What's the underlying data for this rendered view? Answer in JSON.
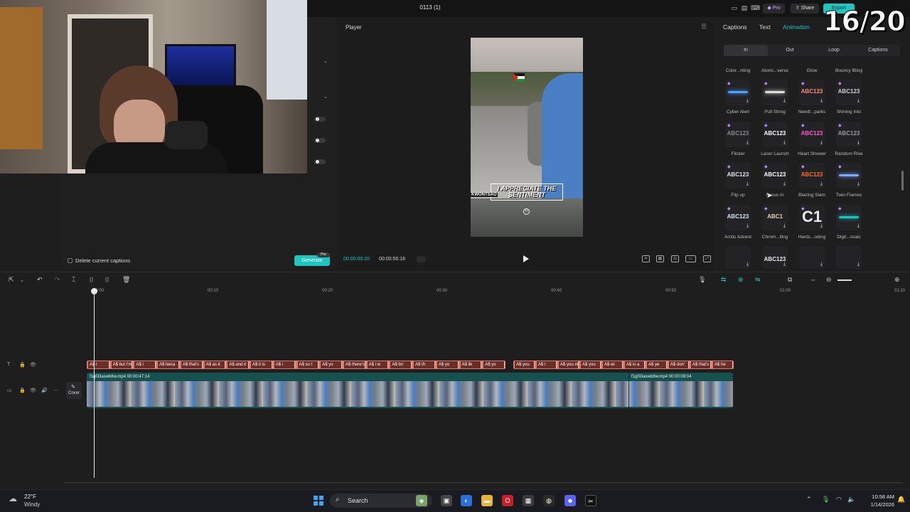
{
  "window": {
    "title": "0113 (1)"
  },
  "topbar": {
    "pro_label": "Pro",
    "share_label": "Share",
    "export_label": "Export"
  },
  "overlay": {
    "counter": "16/20"
  },
  "left_panel": {
    "delete_label": "Delete current captions",
    "generate_label": "Generate",
    "pro_badge": "Pro"
  },
  "player": {
    "title": "Player",
    "current_time": "00:00:00:20",
    "total_time": "00:00:56:18",
    "caption_text": "I APPRECIATE THE SENTIMENT",
    "caption_name": "KWONTSAO"
  },
  "right_panel": {
    "tabs": [
      {
        "label": "Captions",
        "active": false
      },
      {
        "label": "Text",
        "active": false
      },
      {
        "label": "Animation",
        "active": true
      }
    ],
    "subtabs": [
      {
        "label": "In",
        "active": true
      },
      {
        "label": "Out",
        "active": false
      },
      {
        "label": "Loop",
        "active": false
      },
      {
        "label": "Captions",
        "active": false
      }
    ],
    "row0_labels": [
      "Color...nting",
      "Atomi...verse",
      "Glow",
      "Bouncy Bling"
    ],
    "animations": [
      {
        "label": "Cyber Alert",
        "thumb": "",
        "color": "#4aa3ff"
      },
      {
        "label": "Pull String",
        "thumb": "",
        "color": "#dddddd"
      },
      {
        "label": "Needl...parks",
        "thumb": "ABC123",
        "color": "#ff8a7a"
      },
      {
        "label": "Shining Into",
        "thumb": "ABC123",
        "color": "#cfcfcf"
      },
      {
        "label": "Flicker",
        "thumb": "ABC123",
        "color": "#8a8a8a"
      },
      {
        "label": "Laser Launch",
        "thumb": "ABC123",
        "color": "#ffffff"
      },
      {
        "label": "Heart Shower",
        "thumb": "ABC123",
        "color": "#ff5ad1"
      },
      {
        "label": "Random Rise",
        "thumb": "ABC123",
        "color": "#9a9a9a"
      },
      {
        "label": "Flip up",
        "thumb": "ABC123",
        "color": "#e0e0e0"
      },
      {
        "label": "Focus In",
        "thumb": "ABC123",
        "color": "#ffffff"
      },
      {
        "label": "Blazing Slam",
        "thumb": "ABC123",
        "color": "#ff6a2a"
      },
      {
        "label": "Twin Flames",
        "thumb": "",
        "color": "#7aa7ff"
      },
      {
        "label": "Arctic Advent",
        "thumb": "ABC123",
        "color": "#cfe6ff"
      },
      {
        "label": "Chrom...lling",
        "thumb": "ABC1",
        "color": "#e6d2b5"
      },
      {
        "label": "Hardc...oding",
        "thumb": "C1",
        "color": "#e8e8e8"
      },
      {
        "label": "Digit...osaic",
        "thumb": "",
        "color": "#1fc6c0"
      }
    ],
    "last_row_thumbs": [
      "",
      "ABC123",
      "",
      ""
    ]
  },
  "timeline": {
    "ruler": [
      "00:00",
      "00:10",
      "00:20",
      "00:30",
      "00:40",
      "00:50",
      "01:00",
      "01:10"
    ],
    "caption_segments": [
      {
        "text": "A$ i",
        "w": 0
      },
      {
        "text": "A$ but I'm g",
        "w": 0
      },
      {
        "text": "A$ i",
        "w": 0
      },
      {
        "text": "A$ beca",
        "w": 0
      },
      {
        "text": "A$ that's",
        "w": 0
      },
      {
        "text": "A$ as it",
        "w": 0
      },
      {
        "text": "A$ and it",
        "w": 0
      },
      {
        "text": "A$ it is",
        "w": 0
      },
      {
        "text": "A$ i",
        "w": 0
      },
      {
        "text": "A$ so t",
        "w": 0
      },
      {
        "text": "A$ yo",
        "w": 0
      },
      {
        "text": "A$ there's t",
        "w": 0
      },
      {
        "text": "A$ i w",
        "w": 0
      },
      {
        "text": "A$ bri",
        "w": 0
      },
      {
        "text": "A$ th",
        "w": 0
      },
      {
        "text": "A$ yo",
        "w": 0
      },
      {
        "text": "A$ lik",
        "w": 0
      },
      {
        "text": "A$ yo",
        "w": 0
      }
    ],
    "caption_segments_b": [
      {
        "text": "A$ you"
      },
      {
        "text": "A$ l"
      },
      {
        "text": "A$ you m"
      },
      {
        "text": "A$ you"
      },
      {
        "text": "A$ wi"
      },
      {
        "text": "A$ is a"
      },
      {
        "text": "A$ ye"
      },
      {
        "text": "A$ don'"
      },
      {
        "text": "A$ that's"
      },
      {
        "text": "A$ he"
      }
    ],
    "clips": [
      {
        "name": "f1g0i3aswb8w.mp4",
        "duration": "00:00:47:14"
      },
      {
        "name": "f1g0i3aswb8w.mp4",
        "duration": "00:00:09:04"
      }
    ],
    "cover_label": "Cover"
  },
  "taskbar": {
    "weather_temp": "22°F",
    "weather_desc": "Windy",
    "search_label": "Search",
    "time": "10:58 AM",
    "date": "1/14/2026"
  }
}
